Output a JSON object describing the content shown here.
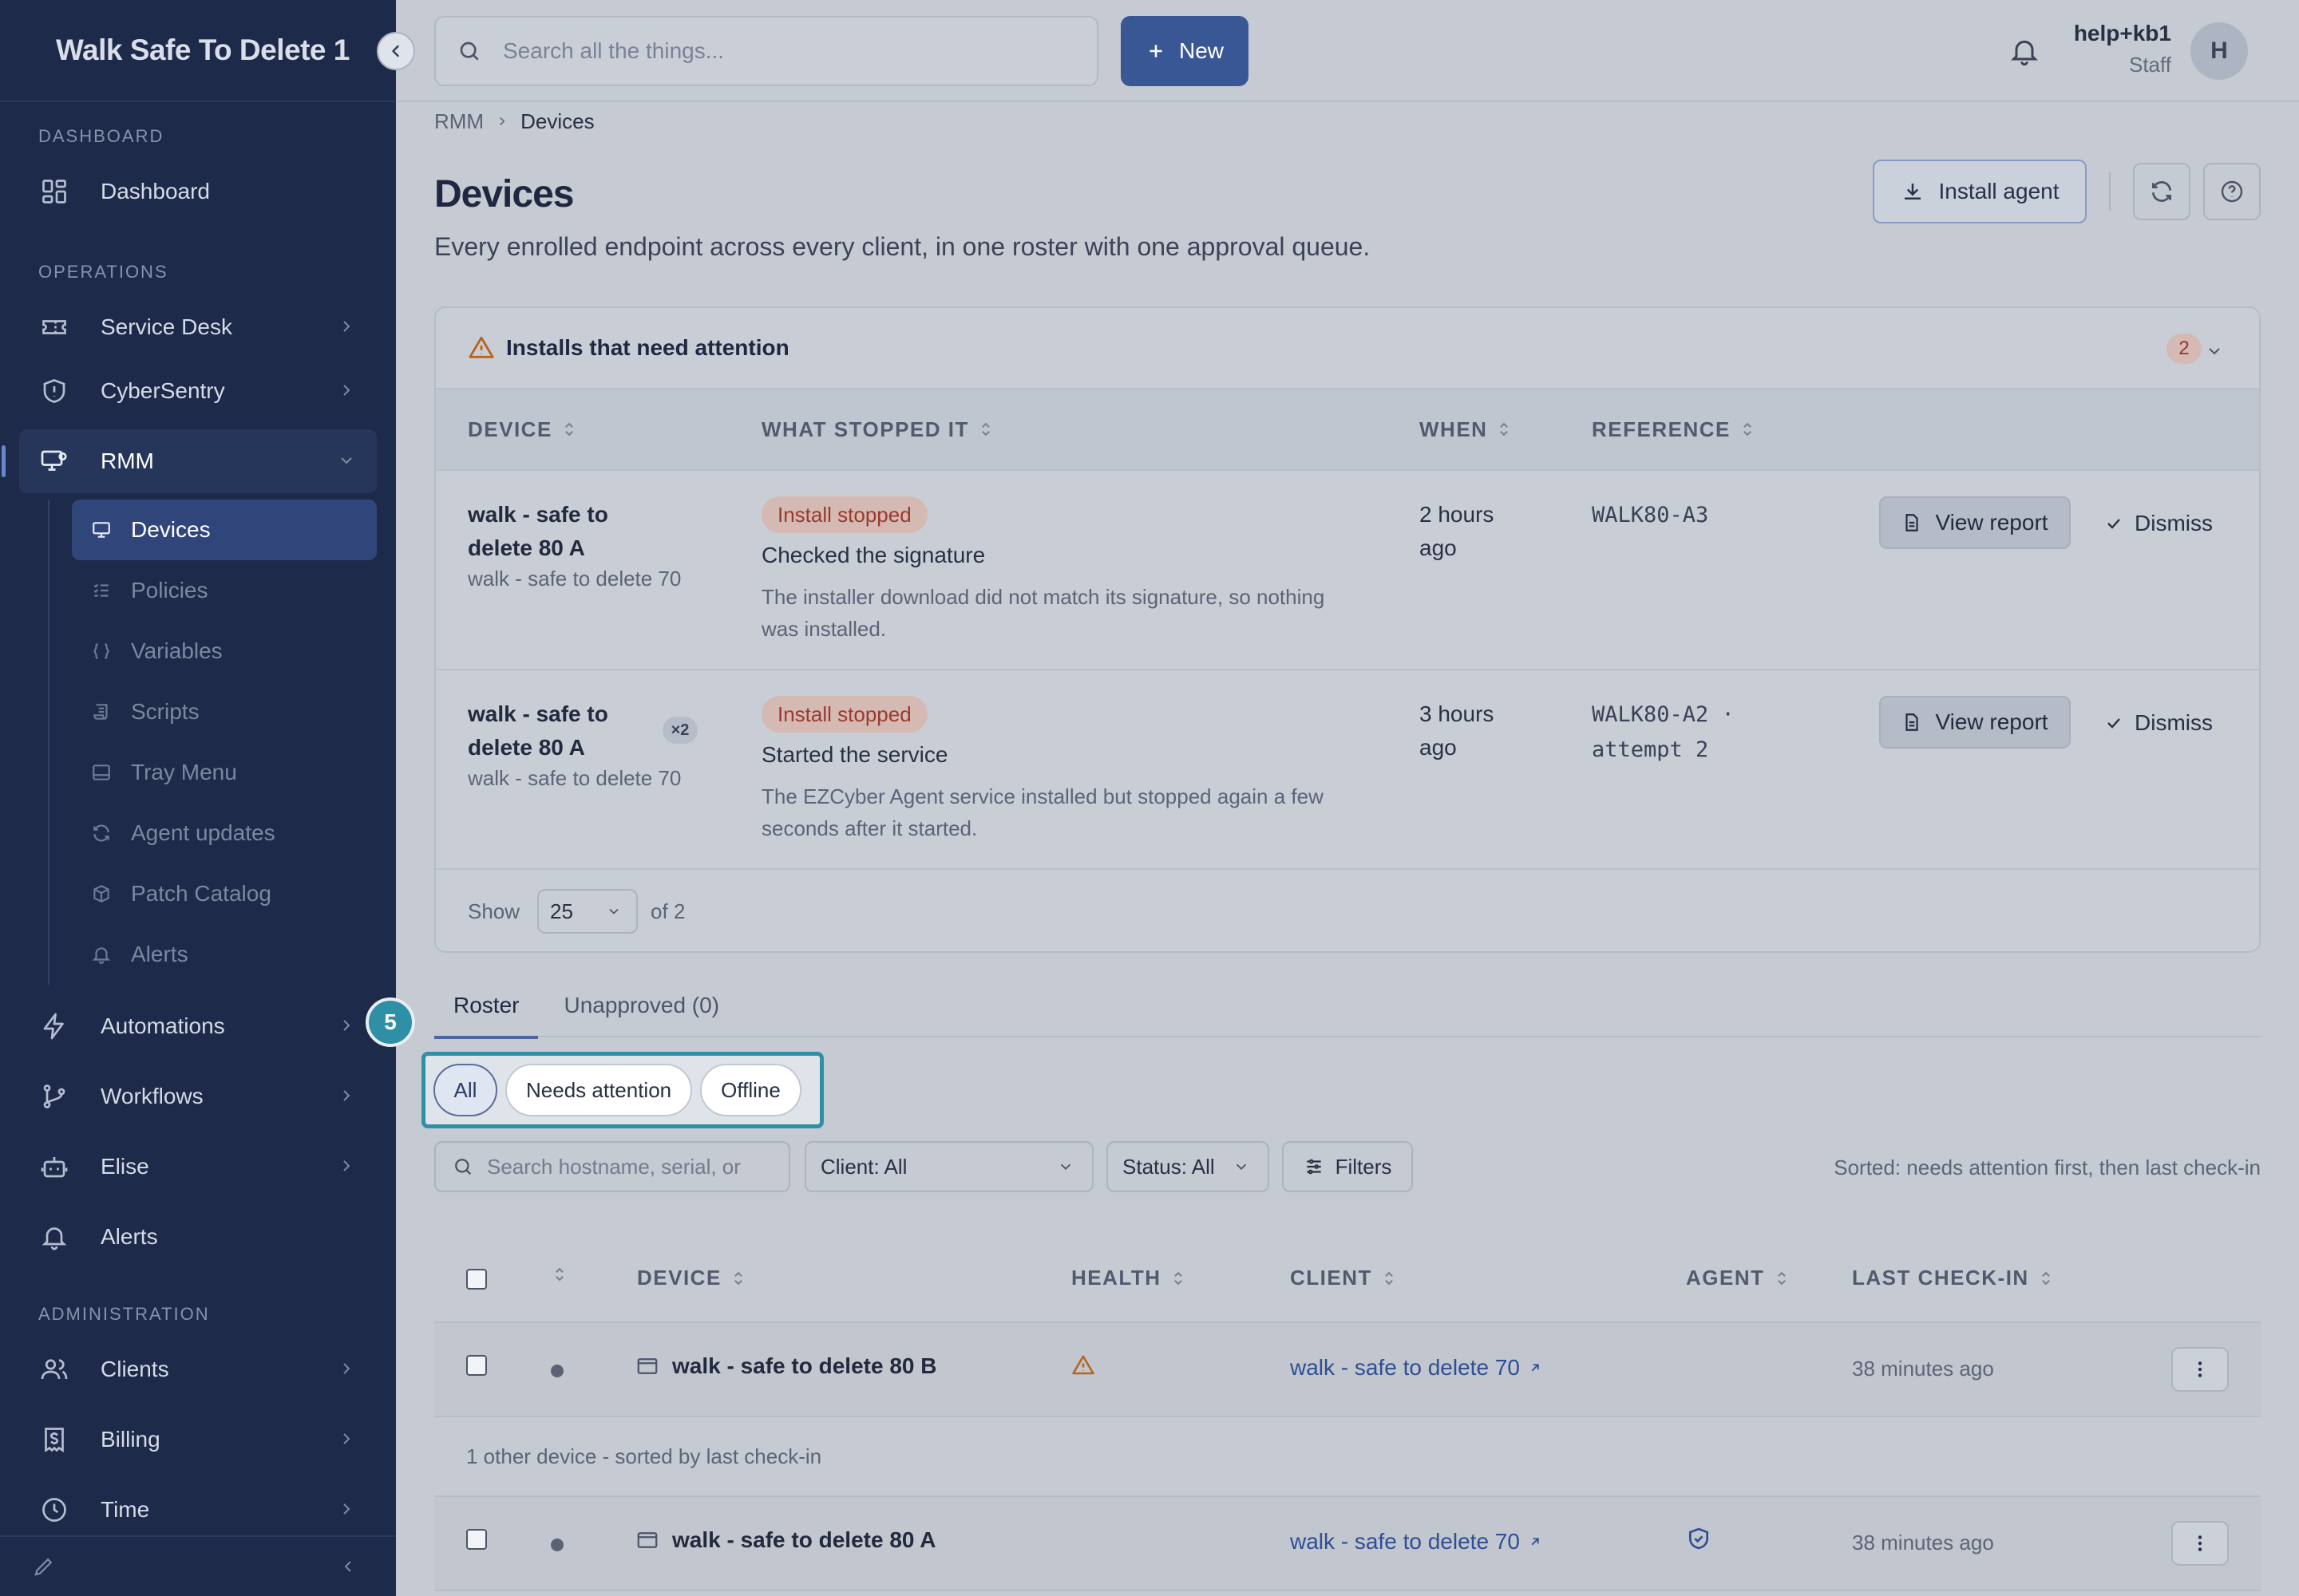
{
  "sidebar": {
    "brand": "Walk Safe To Delete 1",
    "sections": {
      "dashboard": "DASHBOARD",
      "operations": "OPERATIONS",
      "administration": "ADMINISTRATION"
    },
    "items": {
      "dashboard": "Dashboard",
      "service_desk": "Service Desk",
      "cybersentry": "CyberSentry",
      "rmm": "RMM",
      "automations": "Automations",
      "workflows": "Workflows",
      "elise": "Elise",
      "alerts": "Alerts",
      "clients": "Clients",
      "billing": "Billing",
      "time": "Time"
    },
    "rmm_sub": {
      "devices": "Devices",
      "policies": "Policies",
      "variables": "Variables",
      "scripts": "Scripts",
      "tray_menu": "Tray Menu",
      "agent_updates": "Agent updates",
      "patch_catalog": "Patch Catalog",
      "alerts": "Alerts"
    }
  },
  "topbar": {
    "search_placeholder": "Search all the things...",
    "new_label": "New",
    "user_name": "help+kb1",
    "user_role": "Staff",
    "avatar_initial": "H"
  },
  "breadcrumb": {
    "parent": "RMM",
    "current": "Devices"
  },
  "page": {
    "title": "Devices",
    "subtitle": "Every enrolled endpoint across every client, in one roster with one approval queue.",
    "install_agent": "Install agent"
  },
  "attention": {
    "title": "Installs that need attention",
    "count": "2",
    "columns": {
      "device": "DEVICE",
      "what": "WHAT STOPPED IT",
      "when": "WHEN",
      "reference": "REFERENCE"
    },
    "rows": [
      {
        "device": "walk - safe to delete 80 A",
        "client": "walk - safe to delete 70",
        "status": "Install stopped",
        "step": "Checked the signature",
        "desc": "The installer download did not match its signature, so nothing was installed.",
        "when": "2 hours ago",
        "reference": "WALK80-A3",
        "view": "View report",
        "dismiss": "Dismiss"
      },
      {
        "device": "walk - safe to delete 80 A",
        "badge": "×2",
        "client": "walk - safe to delete 70",
        "status": "Install stopped",
        "step": "Started the service",
        "desc": "The EZCyber Agent service installed but stopped again a few seconds after it started.",
        "when": "3 hours ago",
        "reference": "WALK80-A2 · attempt 2",
        "view": "View report",
        "dismiss": "Dismiss"
      }
    ],
    "footer": {
      "show": "Show",
      "page_size": "25",
      "of": "of 2"
    }
  },
  "tabs": {
    "roster": "Roster",
    "unapproved": "Unapproved (0)"
  },
  "step_badge": "5",
  "segments": {
    "all": "All",
    "needs_attention": "Needs attention",
    "offline": "Offline"
  },
  "filters": {
    "search_placeholder": "Search hostname, serial, or",
    "client": "Client: All",
    "status": "Status: All",
    "filters": "Filters",
    "sorted": "Sorted: needs attention first, then last check-in"
  },
  "devices": {
    "columns": {
      "device": "DEVICE",
      "health": "HEALTH",
      "client": "CLIENT",
      "agent": "AGENT",
      "last": "LAST CHECK-IN"
    },
    "rows": [
      {
        "name": "walk - safe to delete 80 B",
        "health": "warning-icon",
        "client": "walk - safe to delete 70",
        "agent": "",
        "last": "38 minutes ago"
      },
      {
        "name": "walk - safe to delete 80 A",
        "health": "",
        "client": "walk - safe to delete 70",
        "agent": "shield-check-icon",
        "last": "38 minutes ago"
      }
    ],
    "group_label": "1 other device - sorted by last check-in"
  },
  "colors": {
    "sidebar": "#1d2a49",
    "primary": "#3a5795",
    "highlight": "#2f8fa6",
    "danger": "#9a3a2d"
  }
}
